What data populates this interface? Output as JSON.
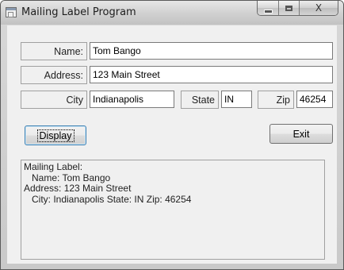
{
  "window": {
    "title": "Mailing Label Program"
  },
  "caption_buttons": {
    "close_glyph": "X"
  },
  "form": {
    "name_label": "Name:",
    "name_value": "Tom Bango",
    "address_label": "Address:",
    "address_value": "123 Main Street",
    "city_label": "City",
    "city_value": "Indianapolis",
    "state_label": "State",
    "state_value": "IN",
    "zip_label": "Zip",
    "zip_value": "46254"
  },
  "buttons": {
    "display_label": "Display",
    "exit_label": "Exit"
  },
  "output": {
    "heading": "Mailing Label:",
    "lines": [
      "",
      "   Name: Tom Bango",
      "Address: 123 Main Street",
      "   City: Indianapolis State: IN Zip: 46254"
    ]
  }
}
